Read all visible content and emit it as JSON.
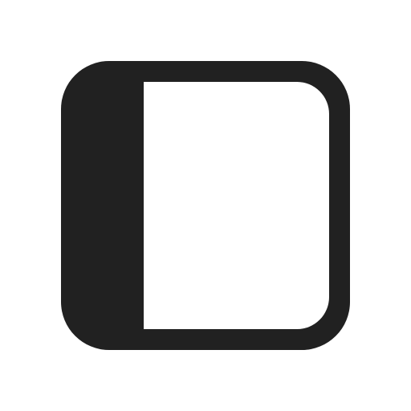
{
  "icon": {
    "name": "sidebar-panel-left-icon",
    "color": "#212121",
    "background": "#ffffff"
  }
}
